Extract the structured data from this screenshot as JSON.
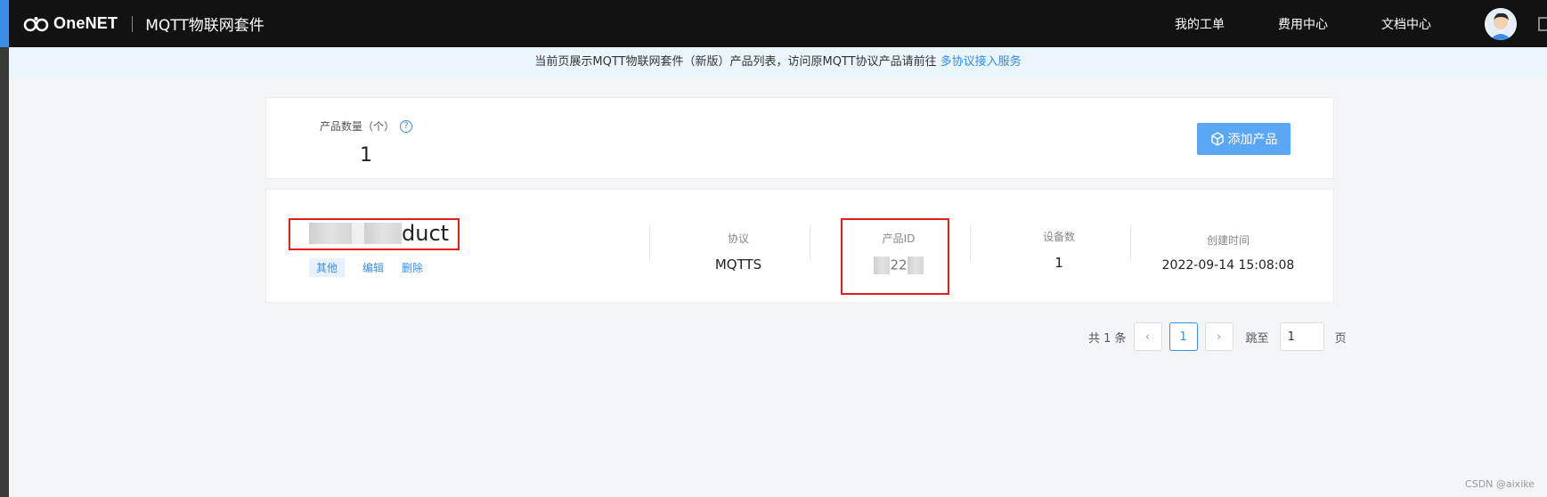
{
  "header": {
    "logo_text": "OneNET",
    "suite_title": "MQTT物联网套件",
    "nav": [
      "我的工单",
      "费用中心",
      "文档中心"
    ]
  },
  "notice": {
    "text": "当前页展示MQTT物联网套件（新版）产品列表，访问原MQTT协议产品请前往",
    "link": "多协议接入服务"
  },
  "summary": {
    "count_label": "产品数量（个）",
    "help": "?",
    "count_value": "1",
    "add_button": "添加产品"
  },
  "product": {
    "name_visible": "duct",
    "tag": "其他",
    "edit": "编辑",
    "delete": "删除",
    "protocol_label": "协议",
    "protocol_value": "MQTTS",
    "id_label": "产品ID",
    "id_value": "22",
    "devices_label": "设备数",
    "devices_value": "1",
    "created_label": "创建时间",
    "created_value": "2022-09-14 15:08:08"
  },
  "pagination": {
    "total": "共 1 条",
    "prev": "‹",
    "current": "1",
    "next": "›",
    "jump_label": "跳至",
    "jump_value": "1",
    "page_suffix": "页"
  },
  "watermark": "CSDN @aixike",
  "colors": {
    "topbar": "#121212",
    "accent": "#3b8ee8",
    "highlight_box": "#e02020"
  }
}
